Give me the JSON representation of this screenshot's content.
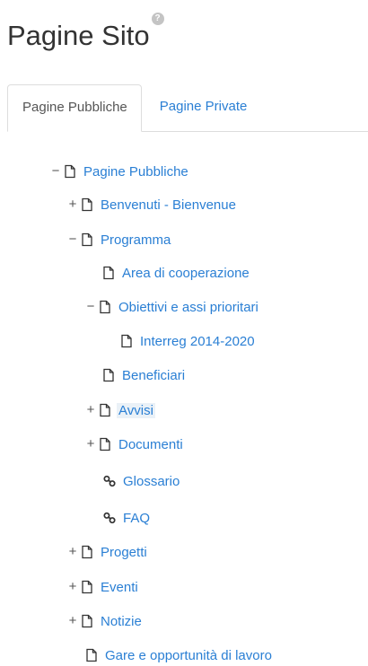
{
  "header": {
    "title": "Pagine Sito",
    "help_symbol": "?"
  },
  "tabs": [
    {
      "label": "Pagine Pubbliche",
      "active": true
    },
    {
      "label": "Pagine Private",
      "active": false
    }
  ],
  "tree": [
    {
      "label": "Pagine Pubbliche",
      "toggle": "−",
      "icon": "page-icon"
    },
    {
      "label": "Benvenuti - Bienvenue",
      "toggle": "+",
      "icon": "page-icon"
    },
    {
      "label": "Programma",
      "toggle": "−",
      "icon": "page-icon"
    },
    {
      "label": "Area di cooperazione",
      "toggle": "",
      "icon": "page-icon"
    },
    {
      "label": "Obiettivi e assi prioritari",
      "toggle": "−",
      "icon": "page-icon"
    },
    {
      "label": "Interreg 2014-2020",
      "toggle": "",
      "icon": "page-icon"
    },
    {
      "label": "Beneficiari",
      "toggle": "",
      "icon": "page-icon"
    },
    {
      "label": "Avvisi",
      "toggle": "+",
      "icon": "page-icon",
      "highlighted": true
    },
    {
      "label": "Documenti",
      "toggle": "+",
      "icon": "page-icon"
    },
    {
      "label": "Glossario",
      "toggle": "",
      "icon": "link-icon"
    },
    {
      "label": "FAQ",
      "toggle": "",
      "icon": "link-icon"
    },
    {
      "label": "Progetti",
      "toggle": "+",
      "icon": "page-icon"
    },
    {
      "label": "Eventi",
      "toggle": "+",
      "icon": "page-icon"
    },
    {
      "label": "Notizie",
      "toggle": "+",
      "icon": "page-icon"
    },
    {
      "label": "Gare e opportunità di lavoro",
      "toggle": "",
      "icon": "page-icon"
    }
  ],
  "colors": {
    "link": "#2a7fd4",
    "text": "#333333",
    "highlight_bg": "#eaf1f7"
  }
}
